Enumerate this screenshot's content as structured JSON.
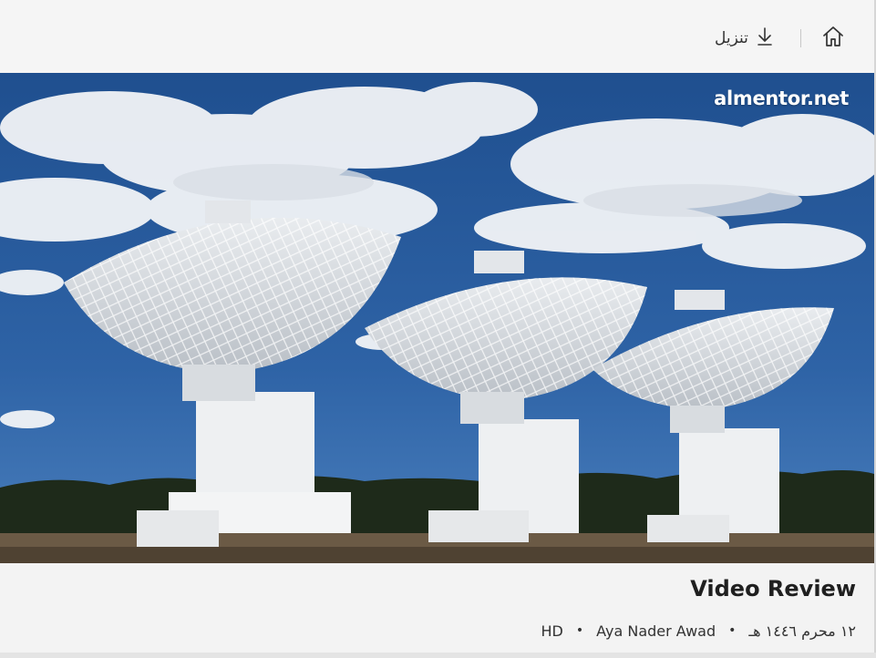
{
  "toolbar": {
    "home_icon": "home-icon",
    "download_icon": "download-icon",
    "download_label": "تنزيل"
  },
  "hero": {
    "brand_logo": "almentor.net",
    "image_description_icon": "radio-telescope-photo"
  },
  "video": {
    "title": "Video Review",
    "date": "١٢ محرم ١٤٤٦ هـ",
    "author": "Aya Nader Awad",
    "quality": "HD"
  },
  "colors": {
    "background": "#f3f3f3",
    "text": "#1f1f1f",
    "sky": "#2a5b9c"
  }
}
